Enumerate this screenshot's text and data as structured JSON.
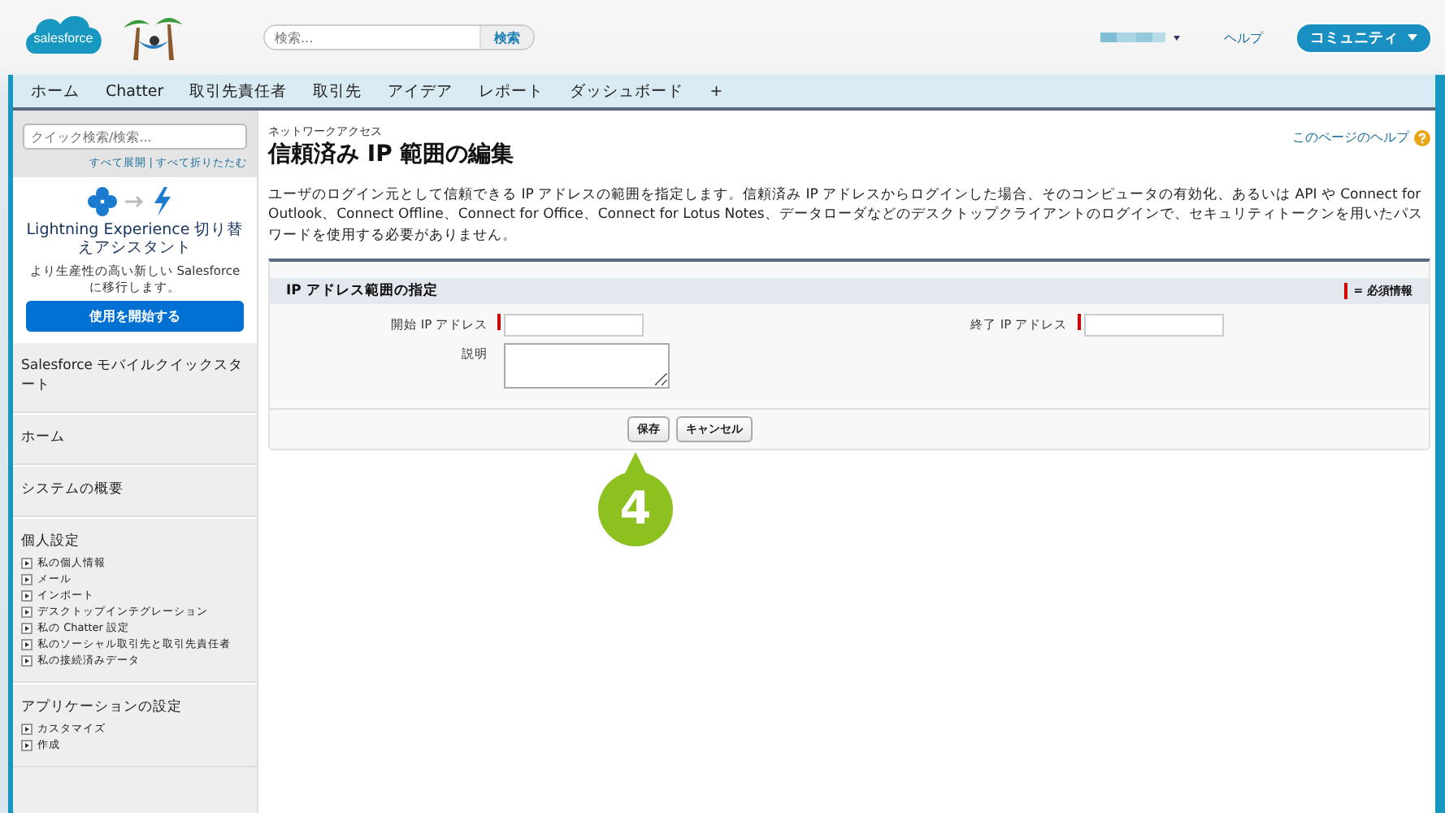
{
  "header": {
    "logo": "salesforce",
    "search": {
      "placeholder": "検索...",
      "button": "検索"
    },
    "help": "ヘルプ",
    "community": "コミュニティ"
  },
  "tabs": [
    {
      "label": "ホーム",
      "selected": false
    },
    {
      "label": "Chatter",
      "selected": false
    },
    {
      "label": "取引先責任者",
      "selected": false
    },
    {
      "label": "取引先",
      "selected": false
    },
    {
      "label": "アイデア",
      "selected": false
    },
    {
      "label": "レポート",
      "selected": false
    },
    {
      "label": "ダッシュボード",
      "selected": false
    },
    {
      "label": "+",
      "selected": false
    }
  ],
  "sidebar": {
    "quick_search": {
      "placeholder": "クイック検索/検索..."
    },
    "expand_all": "すべて展開",
    "separator": "|",
    "collapse_all": "すべて折りたたむ",
    "promo": {
      "title": "Lightning Experience 切り替えアシスタント",
      "text": "より生産性の高い新しい Salesforce に移行します。",
      "button": "使用を開始する"
    },
    "sections": [
      {
        "title": "Salesforce モバイルクイックスタート"
      },
      {
        "title": "ホーム"
      },
      {
        "title": "システムの概要"
      },
      {
        "title": "個人設定",
        "items": [
          "私の個人情報",
          "メール",
          "インポート",
          "デスクトップインテグレーション",
          "私の Chatter 設定",
          "私のソーシャル取引先と取引先責任者",
          "私の接続済みデータ"
        ]
      },
      {
        "title": "アプリケーションの設定",
        "items": [
          "カスタマイズ",
          "作成"
        ]
      }
    ]
  },
  "page": {
    "breadcrumb": "ネットワークアクセス",
    "title": "信頼済み IP 範囲の編集",
    "help_link": "このページのヘルプ",
    "description": "ユーザのログイン元として信頼できる IP アドレスの範囲を指定します。信頼済み IP アドレスからログインした場合、そのコンピュータの有効化、あるいは API や Connect for Outlook、Connect Offline、Connect for Office、Connect for Lotus Notes、データローダなどのデスクトップクライアントのログインで、セキュリティトークンを用いたパスワードを使用する必要がありません。",
    "form": {
      "title": "IP アドレス範囲の指定",
      "required_legend": "= 必須情報",
      "fields": [
        {
          "label": "開始 IP アドレス",
          "kind": "text",
          "required": true
        },
        {
          "label": "終了 IP アドレス",
          "kind": "text",
          "required": true
        },
        {
          "label": "説明",
          "kind": "textarea",
          "required": false
        }
      ],
      "buttons": [
        "保存",
        "キャンセル"
      ]
    }
  },
  "callout": {
    "number": "4"
  }
}
